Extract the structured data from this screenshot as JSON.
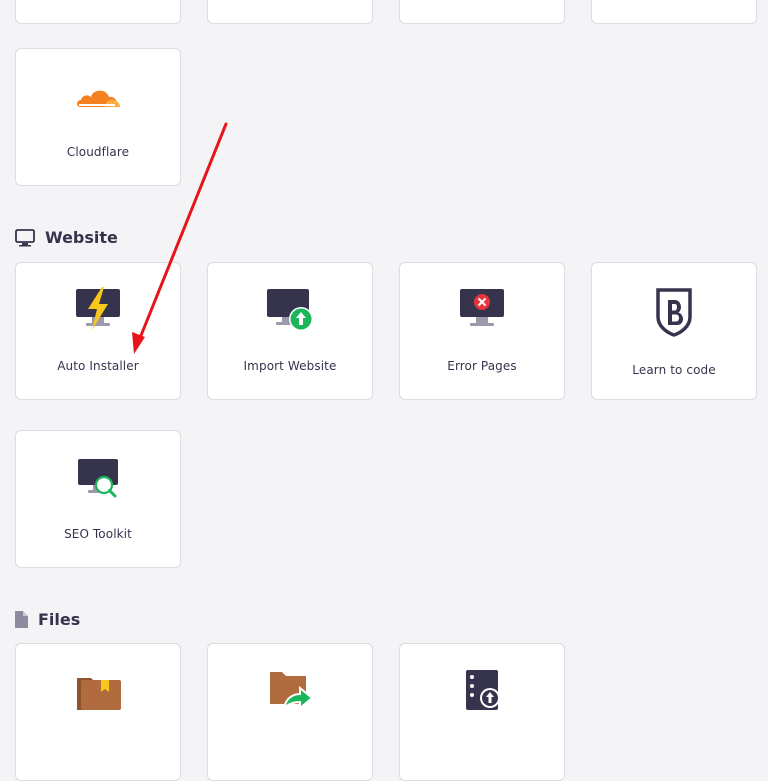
{
  "sections": {
    "website": {
      "title": "Website",
      "icon": "monitor-icon"
    },
    "files": {
      "title": "Files",
      "icon": "file-icon"
    }
  },
  "cards": {
    "cloudflare": {
      "label": "Cloudflare",
      "icon": "cloudflare-cloud-icon"
    },
    "auto_installer": {
      "label": "Auto Installer",
      "icon": "lightning-monitor-icon"
    },
    "import_website": {
      "label": "Import Website",
      "icon": "upload-monitor-icon"
    },
    "error_pages": {
      "label": "Error Pages",
      "icon": "error-monitor-icon"
    },
    "learn_to_code": {
      "label": "Learn to code",
      "icon": "bootstrap-shield-icon"
    },
    "seo_toolkit": {
      "label": "SEO Toolkit",
      "icon": "magnifier-monitor-icon"
    },
    "file_manager": {
      "icon": "folder-bookmark-icon"
    },
    "folder_share": {
      "icon": "folder-share-icon"
    },
    "backups": {
      "icon": "server-upload-icon"
    }
  },
  "colors": {
    "background": "#f4f4f7",
    "card_border": "#dcdce2",
    "cloudflare_orange": "#f48120",
    "lightning_yellow": "#f8c81c",
    "success_green": "#1bb55c",
    "error_red": "#e8333a",
    "folder_brown": "#b06b3f",
    "annotation_red": "#e8141a"
  }
}
